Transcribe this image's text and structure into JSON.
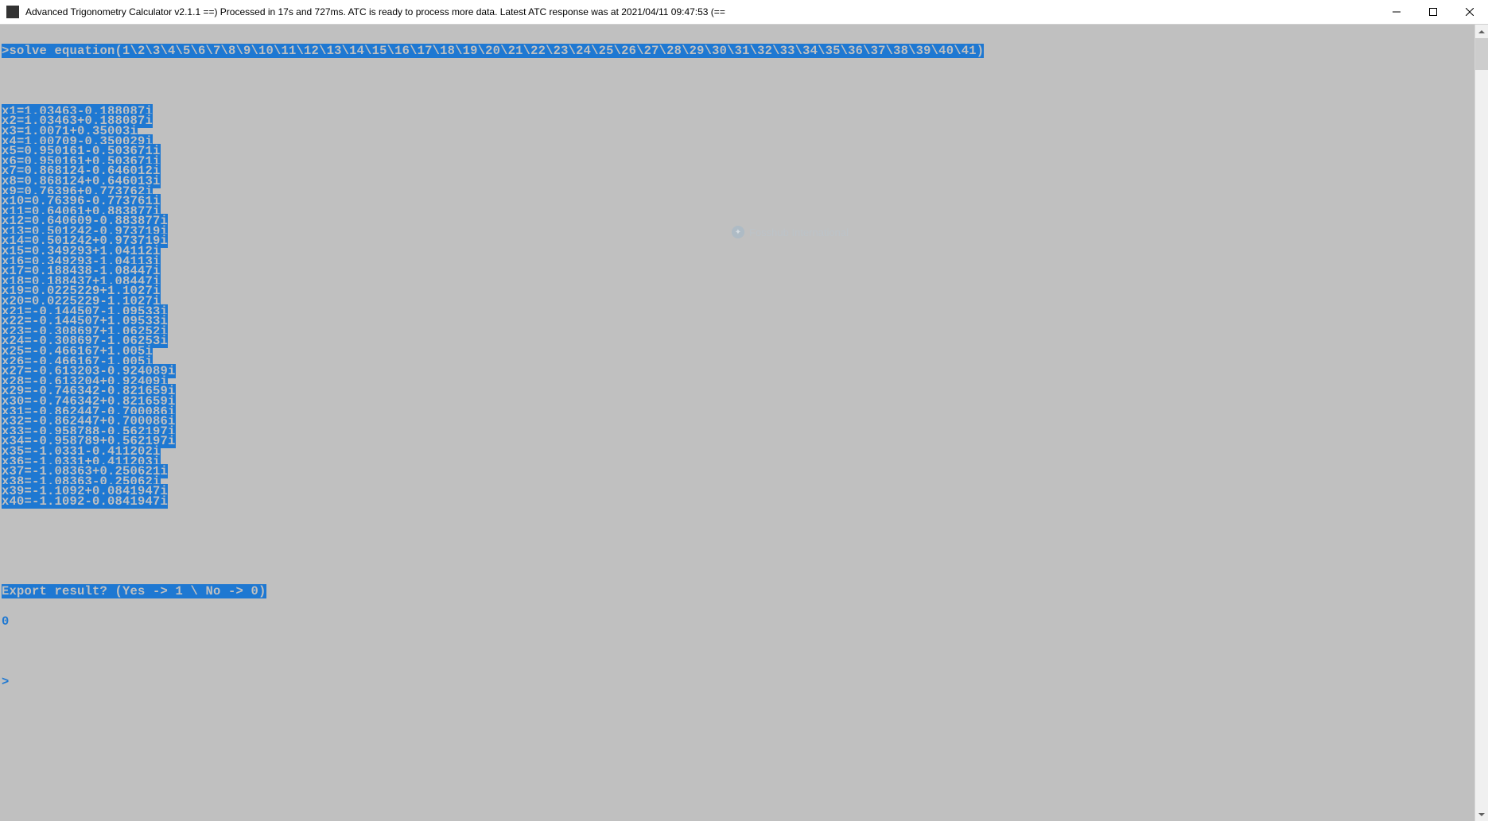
{
  "window": {
    "title": "Advanced Trigonometry Calculator v2.1.1       ==) Processed in 17s and 727ms. ATC is ready to process more data. Latest ATC response was at 2021/04/11 09:47:53 (=="
  },
  "console": {
    "command": ">solve equation(1\\2\\3\\4\\5\\6\\7\\8\\9\\10\\11\\12\\13\\14\\15\\16\\17\\18\\19\\20\\21\\22\\23\\24\\25\\26\\27\\28\\29\\30\\31\\32\\33\\34\\35\\36\\37\\38\\39\\40\\41)",
    "results": [
      "x1=1.03463-0.188087i",
      "x2=1.03463+0.188087i",
      "x3=1.0071+0.35003i",
      "x4=1.00709-0.350029i",
      "x5=0.950161-0.503671i",
      "x6=0.950161+0.503671i",
      "x7=0.868124-0.646012i",
      "x8=0.868124+0.646013i",
      "x9=0.76396+0.773762i",
      "x10=0.76396-0.773761i",
      "x11=0.64061+0.883877i",
      "x12=0.640609-0.883877i",
      "x13=0.501242-0.973719i",
      "x14=0.501242+0.973719i",
      "x15=0.349293+1.04112i",
      "x16=0.349293-1.04113i",
      "x17=0.188438-1.08447i",
      "x18=0.188437+1.08447i",
      "x19=0.0225229+1.1027i",
      "x20=0.0225229-1.1027i",
      "x21=-0.144507-1.09533i",
      "x22=-0.144507+1.09533i",
      "x23=-0.308697+1.06252i",
      "x24=-0.308697-1.06253i",
      "x25=-0.466167+1.005i",
      "x26=-0.466167-1.005i",
      "x27=-0.613203-0.924089i",
      "x28=-0.613204+0.92409i",
      "x29=-0.746342-0.821659i",
      "x30=-0.746342+0.821659i",
      "x31=-0.862447-0.700086i",
      "x32=-0.862447+0.700086i",
      "x33=-0.958788-0.562197i",
      "x34=-0.958789+0.562197i",
      "x35=-1.0331-0.411202i",
      "x36=-1.0331+0.411203i",
      "x37=-1.08363+0.250621i",
      "x38=-1.08363-0.25062i",
      "x39=-1.1092+0.0841947i",
      "x40=-1.1092-0.0841947i"
    ],
    "export_prompt": "Export result? (Yes -> 1 \\ No -> 0)",
    "export_answer": "0",
    "prompt": ">"
  },
  "watermark": {
    "text": "Fosshub International"
  }
}
